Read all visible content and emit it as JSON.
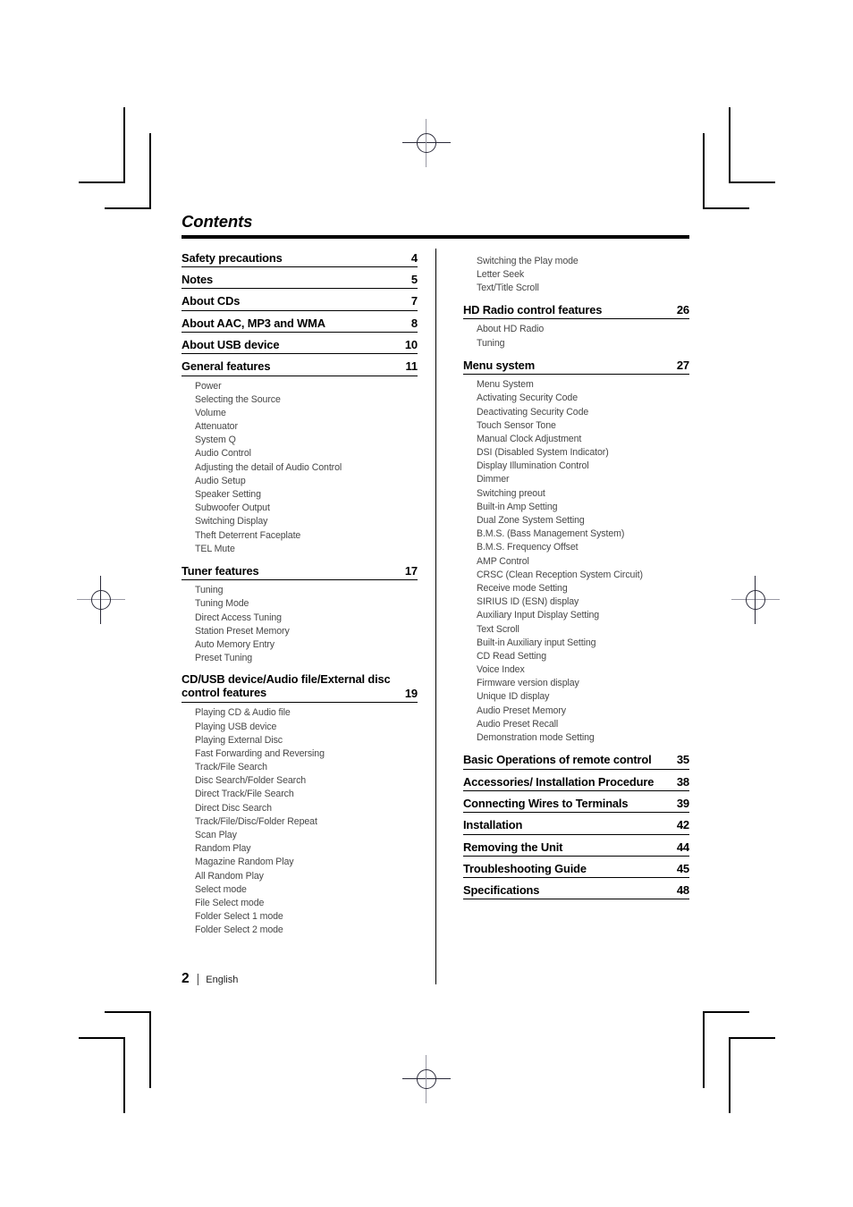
{
  "page": {
    "title": "Contents",
    "footer_page_number": "2",
    "footer_separator": "|",
    "footer_language": "English"
  },
  "columns": {
    "left": [
      {
        "type": "entry",
        "label": "Safety precautions",
        "page": "4"
      },
      {
        "type": "entry",
        "label": "Notes",
        "page": "5"
      },
      {
        "type": "entry",
        "label": "About CDs",
        "page": "7"
      },
      {
        "type": "entry",
        "label": "About AAC, MP3 and WMA",
        "page": "8"
      },
      {
        "type": "entry",
        "label": "About USB device",
        "page": "10"
      },
      {
        "type": "entry",
        "label": "General features",
        "page": "11"
      },
      {
        "type": "subs",
        "items": [
          "Power",
          "Selecting the Source",
          "Volume",
          "Attenuator",
          "System Q",
          "Audio Control",
          "Adjusting the detail of Audio Control",
          "Audio Setup",
          "Speaker Setting",
          "Subwoofer Output",
          "Switching Display",
          "Theft Deterrent Faceplate",
          "TEL Mute"
        ]
      },
      {
        "type": "entry",
        "label": "Tuner features",
        "page": "17"
      },
      {
        "type": "subs",
        "items": [
          "Tuning",
          "Tuning Mode",
          "Direct Access Tuning",
          "Station Preset Memory",
          "Auto Memory Entry",
          "Preset Tuning"
        ]
      },
      {
        "type": "entry",
        "label": "CD/USB device/Audio file/External disc control features",
        "page": "19",
        "twoline": true
      },
      {
        "type": "subs",
        "items": [
          "Playing CD & Audio file",
          "Playing USB device",
          "Playing External Disc",
          "Fast Forwarding and Reversing",
          "Track/File Search",
          "Disc Search/Folder Search",
          "Direct Track/File Search",
          "Direct Disc Search",
          "Track/File/Disc/Folder Repeat",
          "Scan Play",
          "Random Play",
          "Magazine Random Play",
          "All Random Play",
          "Select mode",
          "File Select mode",
          "Folder Select 1 mode",
          "Folder Select 2 mode"
        ]
      }
    ],
    "right": [
      {
        "type": "subs",
        "items": [
          "Switching the Play mode",
          "Letter Seek",
          "Text/Title Scroll"
        ]
      },
      {
        "type": "entry",
        "label": "HD Radio control features",
        "page": "26"
      },
      {
        "type": "subs",
        "items": [
          "About HD Radio",
          "Tuning"
        ]
      },
      {
        "type": "entry",
        "label": "Menu system",
        "page": "27"
      },
      {
        "type": "subs",
        "items": [
          "Menu System",
          "Activating Security Code",
          "Deactivating Security Code",
          "Touch Sensor Tone",
          "Manual Clock Adjustment",
          "DSI (Disabled System Indicator)",
          "Display Illumination Control",
          "Dimmer",
          "Switching preout",
          "Built-in Amp Setting",
          "Dual Zone System Setting",
          "B.M.S. (Bass Management System)",
          "B.M.S. Frequency Offset",
          "AMP Control",
          "CRSC (Clean Reception System Circuit)",
          "Receive mode Setting",
          "SIRIUS ID (ESN) display",
          "Auxiliary Input Display Setting",
          "Text Scroll",
          "Built-in Auxiliary input Setting",
          "CD Read Setting",
          "Voice Index",
          "Firmware version display",
          "Unique ID display",
          "Audio Preset Memory",
          "Audio Preset Recall",
          "Demonstration mode Setting"
        ]
      },
      {
        "type": "entry",
        "label": "Basic Operations of remote control",
        "page": "35"
      },
      {
        "type": "entry",
        "label": "Accessories/ Installation Procedure",
        "page": "38"
      },
      {
        "type": "entry",
        "label": "Connecting Wires to Terminals",
        "page": "39"
      },
      {
        "type": "entry",
        "label": "Installation",
        "page": "42"
      },
      {
        "type": "entry",
        "label": "Removing the Unit",
        "page": "44"
      },
      {
        "type": "entry",
        "label": "Troubleshooting Guide",
        "page": "45"
      },
      {
        "type": "entry",
        "label": "Specifications",
        "page": "48"
      }
    ]
  }
}
